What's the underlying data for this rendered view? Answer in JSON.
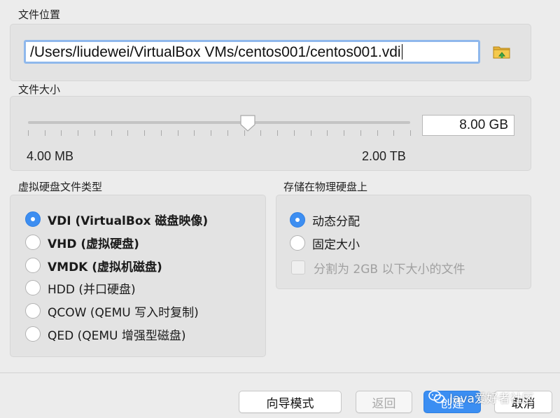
{
  "file_location": {
    "label": "文件位置",
    "path_value": "/Users/liudewei/VirtualBox VMs/centos001/centos001.vdi",
    "folder_icon": "folder-browse-icon"
  },
  "file_size": {
    "label": "文件大小",
    "value": "8.00 GB",
    "min_label": "4.00 MB",
    "max_label": "2.00 TB",
    "slider_level": 0.575
  },
  "disk_type": {
    "label": "虚拟硬盘文件类型",
    "options": [
      {
        "label": "VDI (VirtualBox 磁盘映像)",
        "checked": true
      },
      {
        "label": "VHD (虚拟硬盘)",
        "checked": false
      },
      {
        "label": "VMDK (虚拟机磁盘)",
        "checked": false
      },
      {
        "label": "HDD (并口硬盘)",
        "checked": false
      },
      {
        "label": "QCOW (QEMU 写入时复制)",
        "checked": false
      },
      {
        "label": "QED (QEMU 增强型磁盘)",
        "checked": false
      }
    ]
  },
  "storage": {
    "label": "存储在物理硬盘上",
    "options": [
      {
        "label": "动态分配",
        "checked": true
      },
      {
        "label": "固定大小",
        "checked": false
      }
    ],
    "split_checkbox": {
      "label": "分割为 2GB 以下大小的文件",
      "checked": false,
      "enabled": false
    }
  },
  "buttons": {
    "guided_mode": "向导模式",
    "back": "返回",
    "create": "创建",
    "cancel": "取消"
  },
  "watermark": {
    "text": "Java爱好者社区",
    "icon": "wechat-icon"
  },
  "colors": {
    "accent": "#3b8ef2",
    "focus_ring": "#8fb8ec"
  }
}
